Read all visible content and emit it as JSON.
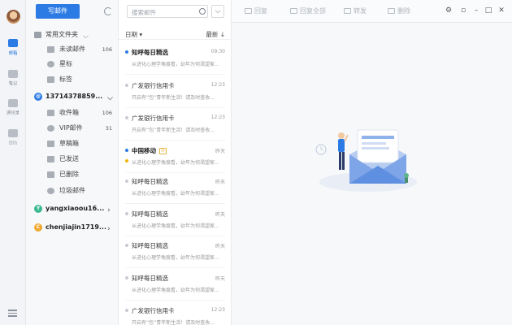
{
  "rail": {
    "items": [
      {
        "label": "邮箱",
        "icon": "mail-icon",
        "active": true
      },
      {
        "label": "笔记",
        "icon": "note-icon",
        "active": false
      },
      {
        "label": "通讯录",
        "icon": "contacts-icon",
        "active": false
      },
      {
        "label": "日历",
        "icon": "calendar-icon",
        "active": false
      }
    ]
  },
  "folders": {
    "compose_label": "写邮件",
    "common_group": "常用文件夹",
    "common_items": [
      {
        "label": "未读邮件",
        "count": "106"
      },
      {
        "label": "星标",
        "count": ""
      },
      {
        "label": "标签",
        "count": ""
      }
    ],
    "account1": {
      "name": "13714378859...",
      "items": [
        {
          "label": "收件箱",
          "count": "106"
        },
        {
          "label": "VIP邮件",
          "count": "31"
        },
        {
          "label": "草稿箱",
          "count": ""
        },
        {
          "label": "已发送",
          "count": ""
        },
        {
          "label": "已删除",
          "count": ""
        },
        {
          "label": "垃圾邮件",
          "count": ""
        }
      ]
    },
    "account2": {
      "initial": "Y",
      "name": "yangxiaoou16..."
    },
    "account3": {
      "initial": "C",
      "name": "chenjiajin1719..."
    }
  },
  "list": {
    "search_placeholder": "搜索邮件",
    "sort_left": "日期",
    "sort_right": "最新",
    "mails": [
      {
        "sender": "知呼每日精选",
        "time": "09:30",
        "preview": "从进化心理学角度看，幼年为何渴望家...",
        "unread": true,
        "tag": false
      },
      {
        "sender": "广发银行信用卡",
        "time": "12:23",
        "preview": "开启有“包”青年新生活！请及时查收...",
        "unread": false,
        "tag": false
      },
      {
        "sender": "广发银行信用卡",
        "time": "12:23",
        "preview": "开启有“包”青年新生活！请及时查收...",
        "unread": false,
        "tag": false
      },
      {
        "sender": "中国移动",
        "time": "昨天",
        "preview": "从进化心理学角度看，幼年为何渴望家...",
        "unread": true,
        "tag": true
      },
      {
        "sender": "知呼每日精选",
        "time": "昨天",
        "preview": "从进化心理学角度看，幼年为何渴望家...",
        "unread": false,
        "tag": false
      },
      {
        "sender": "知呼每日精选",
        "time": "昨天",
        "preview": "从进化心理学角度看，幼年为何渴望家...",
        "unread": false,
        "tag": false
      },
      {
        "sender": "知呼每日精选",
        "time": "昨天",
        "preview": "从进化心理学角度看，幼年为何渴望家...",
        "unread": false,
        "tag": false
      },
      {
        "sender": "知呼每日精选",
        "time": "昨天",
        "preview": "从进化心理学角度看，幼年为何渴望家...",
        "unread": false,
        "tag": false
      },
      {
        "sender": "广发银行信用卡",
        "time": "12:23",
        "preview": "开启有“包”青年新生活！请及时查收...",
        "unread": false,
        "tag": false
      }
    ]
  },
  "toolbar": {
    "reply": "回复",
    "reply_all": "回复全部",
    "forward": "转发",
    "delete": "删除"
  },
  "colors": {
    "accent": "#2c7be5",
    "account2": "#3bb98f",
    "account3": "#f0a830"
  }
}
